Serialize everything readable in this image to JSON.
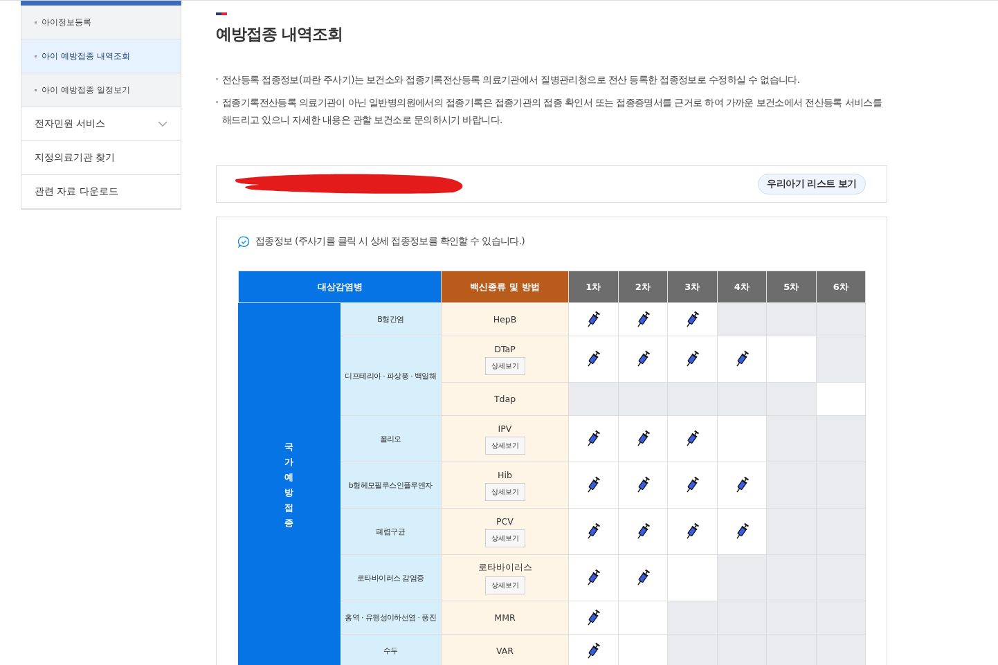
{
  "sidebar": {
    "items": [
      {
        "label": "아이정보등록",
        "kind": "sub",
        "selected": false
      },
      {
        "label": "아이 예방접종 내역조회",
        "kind": "sub",
        "selected": true
      },
      {
        "label": "아이 예방접종 일정보기",
        "kind": "sub",
        "selected": false
      },
      {
        "label": "전자민원 서비스",
        "kind": "dropdown",
        "expanded": false
      },
      {
        "label": "지정의료기관 찾기",
        "kind": "main"
      },
      {
        "label": "관련 자료 다운로드",
        "kind": "main"
      }
    ]
  },
  "page": {
    "title": "예방접종 내역조회",
    "notes": [
      "전산등록 접종정보(파란 주사기)는 보건소와 접종기록전산등록 의료기관에서 질병관리청으로 전산 등록한 접종정보로 수정하실 수 없습니다.",
      "접종기록전산등록 의료기관이 아닌 일반병의원에서의 접종기록은 접종기관의 접종 확인서 또는 접종증명서를 근거로 하여 가까운 보건소에서 전산등록 서비스를 해드리고 있으니 자세한 내용은 관할 보건소로 문의하시기 바랍니다."
    ]
  },
  "child_bar": {
    "button": "우리아기 리스트 보기"
  },
  "vaccination": {
    "caption": "접종정보 (주사기를 클릭 시 상세 접종정보를 확인할 수 있습니다.)",
    "columns": {
      "disease": "대상감염병",
      "vaccine": "백신종류 및 방법",
      "doses": [
        "1차",
        "2차",
        "3차",
        "4차",
        "5차",
        "6차"
      ]
    },
    "category": "국가예방접종",
    "diseases": [
      {
        "name": "B형간염",
        "vaccines": [
          {
            "name": "HepB",
            "doses": [
              {
                "kind": "given"
              },
              {
                "kind": "given"
              },
              {
                "kind": "given"
              },
              {
                "kind": "unavailable"
              },
              {
                "kind": "unavailable"
              },
              {
                "kind": "unavailable"
              }
            ]
          }
        ]
      },
      {
        "name": "디프테리아 · 파상풍 · 백일해",
        "vaccines": [
          {
            "name": "DTaP",
            "detail": "상세보기",
            "doses": [
              {
                "kind": "given"
              },
              {
                "kind": "given"
              },
              {
                "kind": "given"
              },
              {
                "kind": "given"
              },
              {
                "kind": "open"
              },
              {
                "kind": "unavailable"
              }
            ]
          },
          {
            "name": "Tdap",
            "doses": [
              {
                "kind": "unavailable"
              },
              {
                "kind": "unavailable"
              },
              {
                "kind": "unavailable"
              },
              {
                "kind": "unavailable"
              },
              {
                "kind": "unavailable"
              },
              {
                "kind": "open"
              }
            ]
          }
        ]
      },
      {
        "name": "폴리오",
        "vaccines": [
          {
            "name": "IPV",
            "detail": "상세보기",
            "doses": [
              {
                "kind": "given"
              },
              {
                "kind": "given"
              },
              {
                "kind": "given"
              },
              {
                "kind": "open"
              },
              {
                "kind": "unavailable"
              },
              {
                "kind": "unavailable"
              }
            ]
          }
        ]
      },
      {
        "name": "b형헤모필루스인플루엔자",
        "vaccines": [
          {
            "name": "Hib",
            "detail": "상세보기",
            "doses": [
              {
                "kind": "given"
              },
              {
                "kind": "given"
              },
              {
                "kind": "given"
              },
              {
                "kind": "given"
              },
              {
                "kind": "unavailable"
              },
              {
                "kind": "unavailable"
              }
            ]
          }
        ]
      },
      {
        "name": "폐렴구균",
        "vaccines": [
          {
            "name": "PCV",
            "detail": "상세보기",
            "doses": [
              {
                "kind": "given"
              },
              {
                "kind": "given"
              },
              {
                "kind": "given"
              },
              {
                "kind": "given"
              },
              {
                "kind": "unavailable"
              },
              {
                "kind": "unavailable"
              }
            ]
          }
        ]
      },
      {
        "name": "로타바이러스 감염증",
        "vaccines": [
          {
            "name": "로타바이러스",
            "detail": "상세보기",
            "doses": [
              {
                "kind": "given"
              },
              {
                "kind": "given"
              },
              {
                "kind": "open"
              },
              {
                "kind": "unavailable"
              },
              {
                "kind": "unavailable"
              },
              {
                "kind": "unavailable"
              }
            ]
          }
        ]
      },
      {
        "name": "홍역 · 유행성이하선염 · 풍진",
        "vaccines": [
          {
            "name": "MMR",
            "doses": [
              {
                "kind": "given"
              },
              {
                "kind": "open"
              },
              {
                "kind": "unavailable"
              },
              {
                "kind": "unavailable"
              },
              {
                "kind": "unavailable"
              },
              {
                "kind": "unavailable"
              }
            ]
          }
        ]
      },
      {
        "name": "수두",
        "vaccines": [
          {
            "name": "VAR",
            "doses": [
              {
                "kind": "given"
              },
              {
                "kind": "open"
              },
              {
                "kind": "unavailable"
              },
              {
                "kind": "unavailable"
              },
              {
                "kind": "unavailable"
              },
              {
                "kind": "unavailable"
              }
            ]
          }
        ]
      }
    ]
  }
}
